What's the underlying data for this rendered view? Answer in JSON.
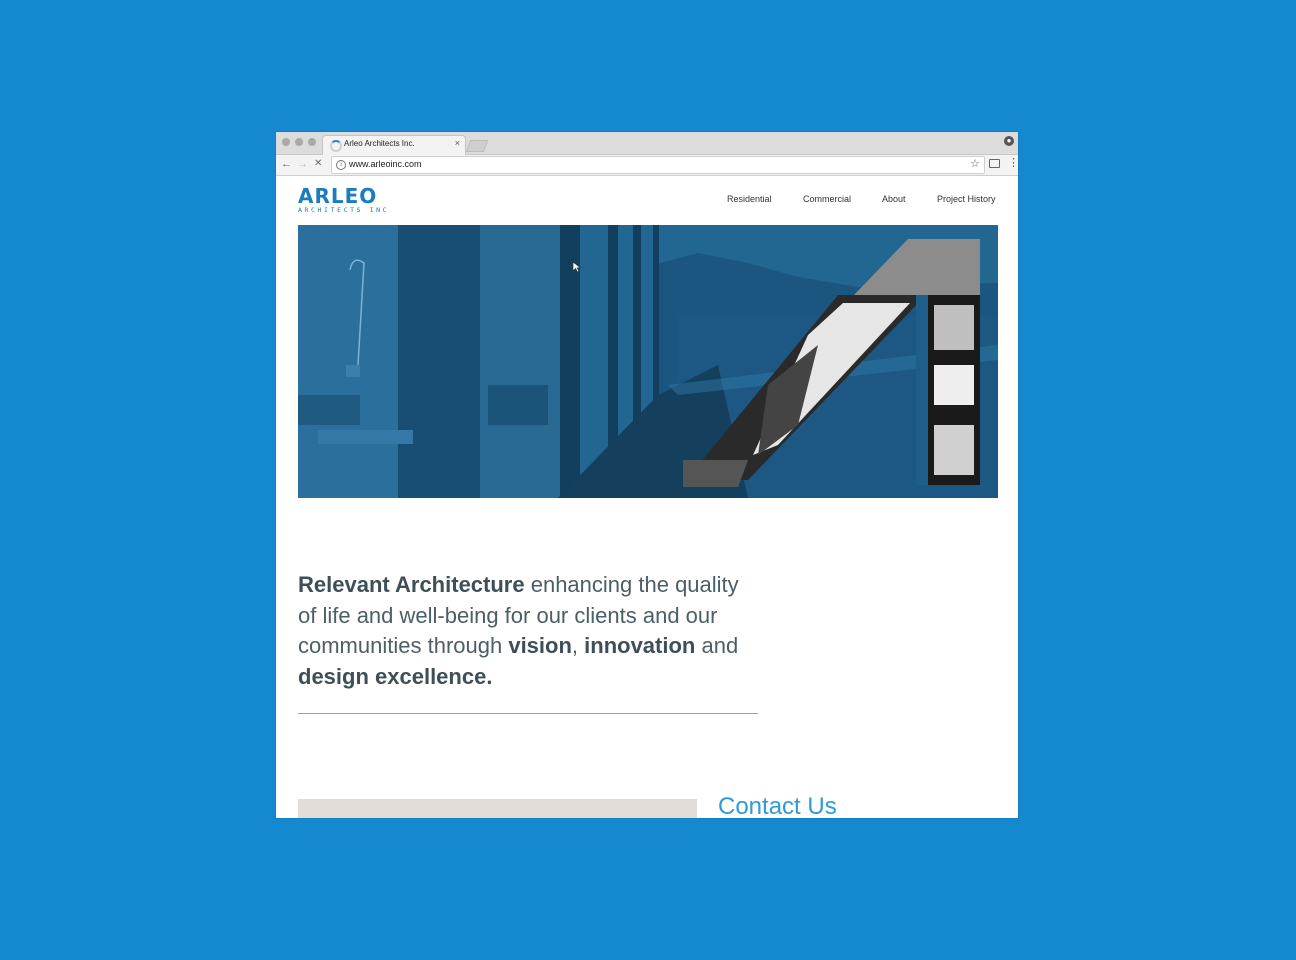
{
  "browser": {
    "tab_title": "Arleo Architects Inc.",
    "tab_close": "×",
    "url": "www.arleoinc.com",
    "back_icon": "←",
    "forward_icon": "→",
    "stop_icon": "✕",
    "star_icon": "☆",
    "menu_icon": "⋮"
  },
  "site": {
    "logo": {
      "name": "ARLEO",
      "sub": "ARCHITECTS INC"
    },
    "nav": [
      "Residential",
      "Commercial",
      "About",
      "Project History"
    ],
    "tagline": {
      "b1": "Relevant Architecture",
      "t1": " enhancing the quality of life and well-being for our clients and our communities through ",
      "b2": "vision",
      "t2": ", ",
      "b3": "innovation",
      "t3": " and ",
      "b4": "design excellence."
    },
    "contact_heading": "Contact Us"
  },
  "colors": {
    "background": "#1589cf",
    "brand_blue": "#1b7bc0",
    "contact_blue": "#2e9bd8",
    "text_slate": "#4c5e66"
  }
}
